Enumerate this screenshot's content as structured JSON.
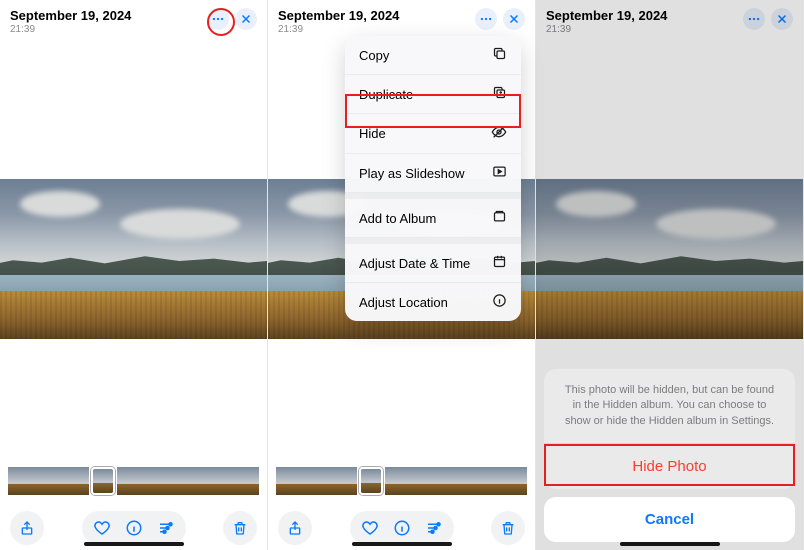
{
  "header": {
    "title": "September 19, 2024",
    "time": "21:39"
  },
  "menu": {
    "copy": "Copy",
    "duplicate": "Duplicate",
    "hide": "Hide",
    "slideshow": "Play as Slideshow",
    "add_album": "Add to Album",
    "adj_date": "Adjust Date & Time",
    "adj_loc": "Adjust Location"
  },
  "sheet": {
    "message": "This photo will be hidden, but can be found in the Hidden album. You can choose to show or hide the Hidden album in Settings.",
    "hide": "Hide Photo",
    "cancel": "Cancel"
  },
  "colors": {
    "accent": "#0a7aff",
    "danger": "#ff3b30"
  }
}
